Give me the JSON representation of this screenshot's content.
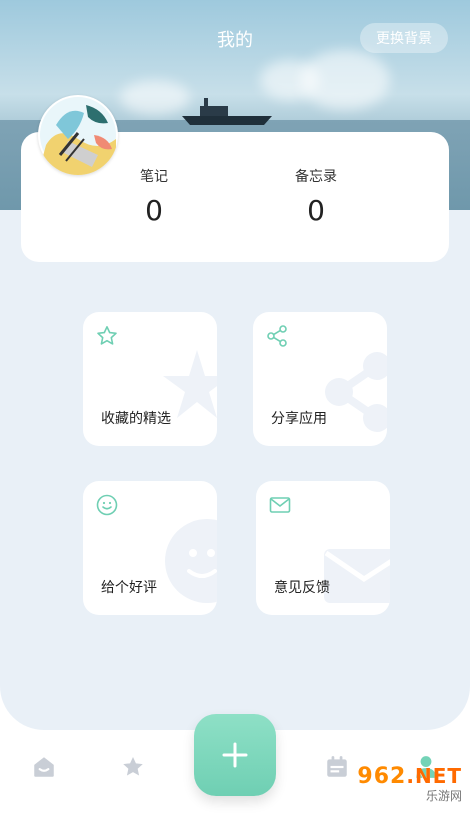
{
  "header": {
    "title": "我的",
    "change_bg_label": "更换背景"
  },
  "stats": {
    "notes_label": "笔记",
    "notes_count": "0",
    "memo_label": "备忘录",
    "memo_count": "0"
  },
  "cards": {
    "favorites_label": "收藏的精选",
    "share_label": "分享应用",
    "rate_label": "给个好评",
    "feedback_label": "意见反馈"
  },
  "nav": {
    "accent_color": "#74d3b7",
    "icons": [
      "home-icon",
      "star-icon",
      "add-icon",
      "calendar-icon",
      "profile-icon"
    ]
  },
  "watermark": {
    "brand": "962",
    "tld": ".NET",
    "sub": "乐游网"
  }
}
